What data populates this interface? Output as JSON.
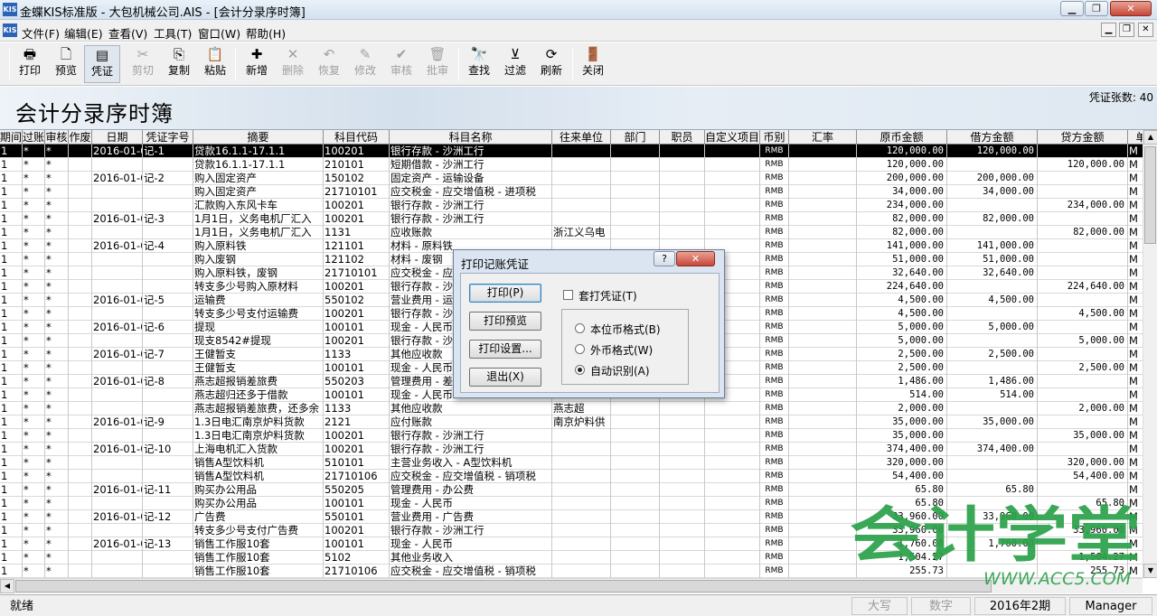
{
  "window": {
    "title": "金蝶KIS标准版 - 大包机械公司.AIS - [会计分录序时簿]",
    "app_icon": "KIS"
  },
  "menu": [
    "文件(F)",
    "编辑(E)",
    "查看(V)",
    "工具(T)",
    "窗口(W)",
    "帮助(H)"
  ],
  "toolbar": [
    {
      "label": "打印",
      "icon": "printer-icon",
      "enabled": true
    },
    {
      "label": "预览",
      "icon": "preview-icon",
      "enabled": true
    },
    {
      "label": "凭证",
      "icon": "voucher-icon",
      "enabled": true
    },
    {
      "label": "剪切",
      "icon": "cut-icon",
      "enabled": false
    },
    {
      "label": "复制",
      "icon": "copy-icon",
      "enabled": true
    },
    {
      "label": "粘贴",
      "icon": "paste-icon",
      "enabled": true
    },
    {
      "label": "新增",
      "icon": "new-icon",
      "enabled": true
    },
    {
      "label": "删除",
      "icon": "delete-icon",
      "enabled": false
    },
    {
      "label": "恢复",
      "icon": "undo-icon",
      "enabled": false
    },
    {
      "label": "修改",
      "icon": "edit-icon",
      "enabled": false
    },
    {
      "label": "审核",
      "icon": "audit-icon",
      "enabled": false
    },
    {
      "label": "批审",
      "icon": "batch-audit-icon",
      "enabled": false
    },
    {
      "label": "查找",
      "icon": "binoculars-icon",
      "enabled": true
    },
    {
      "label": "过滤",
      "icon": "filter-icon",
      "enabled": true
    },
    {
      "label": "刷新",
      "icon": "refresh-icon",
      "enabled": true
    },
    {
      "label": "关闭",
      "icon": "close-door-icon",
      "enabled": true
    }
  ],
  "report": {
    "title": "会计分录序时簿",
    "voucher_count": "凭证张数: 40"
  },
  "columns": [
    "期间",
    "过账",
    "审核",
    "作废",
    "日期",
    "凭证字号",
    "摘要",
    "科目代码",
    "科目名称",
    "往来单位",
    "部门",
    "职员",
    "自定义项目",
    "币别",
    "汇率",
    "原币金额",
    "借方金额",
    "贷方金额",
    "单"
  ],
  "rows": [
    [
      "1",
      "*",
      "*",
      "",
      "2016-01-0",
      "记-1",
      "贷款16.1.1-17.1.1",
      "100201",
      "银行存款 - 沙洲工行",
      "",
      "",
      "",
      "",
      "RMB",
      "",
      "120,000.00",
      "120,000.00",
      "",
      "M"
    ],
    [
      "1",
      "*",
      "*",
      "",
      "",
      "",
      "贷款16.1.1-17.1.1",
      "210101",
      "短期借款 - 沙洲工行",
      "",
      "",
      "",
      "",
      "RMB",
      "",
      "120,000.00",
      "",
      "120,000.00",
      "M"
    ],
    [
      "1",
      "*",
      "*",
      "",
      "2016-01-0",
      "记-2",
      "购入固定资产",
      "150102",
      "固定资产 - 运输设备",
      "",
      "",
      "",
      "",
      "RMB",
      "",
      "200,000.00",
      "200,000.00",
      "",
      "M"
    ],
    [
      "1",
      "*",
      "*",
      "",
      "",
      "",
      "购入固定资产",
      "21710101",
      "应交税金 - 应交增值税 - 进项税",
      "",
      "",
      "",
      "",
      "RMB",
      "",
      "34,000.00",
      "34,000.00",
      "",
      "M"
    ],
    [
      "1",
      "*",
      "*",
      "",
      "",
      "",
      "汇款购入东风卡车",
      "100201",
      "银行存款 - 沙洲工行",
      "",
      "",
      "",
      "",
      "RMB",
      "",
      "234,000.00",
      "",
      "234,000.00",
      "M"
    ],
    [
      "1",
      "*",
      "*",
      "",
      "2016-01-0",
      "记-3",
      "1月1日，义务电机厂汇入",
      "100201",
      "银行存款 - 沙洲工行",
      "",
      "",
      "",
      "",
      "RMB",
      "",
      "82,000.00",
      "82,000.00",
      "",
      "M"
    ],
    [
      "1",
      "*",
      "*",
      "",
      "",
      "",
      "1月1日，义务电机厂汇入",
      "1131",
      "应收账款",
      "浙江义乌电",
      "",
      "",
      "",
      "RMB",
      "",
      "82,000.00",
      "",
      "82,000.00",
      "M"
    ],
    [
      "1",
      "*",
      "*",
      "",
      "2016-01-0",
      "记-4",
      "购入原料铁",
      "121101",
      "材料 - 原料铁",
      "",
      "",
      "",
      "",
      "RMB",
      "",
      "141,000.00",
      "141,000.00",
      "",
      "M"
    ],
    [
      "1",
      "*",
      "*",
      "",
      "",
      "",
      "购入废钢",
      "121102",
      "材料 - 废钢",
      "",
      "",
      "",
      "",
      "RMB",
      "",
      "51,000.00",
      "51,000.00",
      "",
      "M"
    ],
    [
      "1",
      "*",
      "*",
      "",
      "",
      "",
      "购入原料铁，废钢",
      "21710101",
      "应交税金 - 应",
      "",
      "",
      "",
      "",
      "RMB",
      "",
      "32,640.00",
      "32,640.00",
      "",
      "M"
    ],
    [
      "1",
      "*",
      "*",
      "",
      "",
      "",
      "转支多少号购入原材料",
      "100201",
      "银行存款 - 沙",
      "",
      "",
      "",
      "",
      "RMB",
      "",
      "224,640.00",
      "",
      "224,640.00",
      "M"
    ],
    [
      "1",
      "*",
      "*",
      "",
      "2016-01-0",
      "记-5",
      "运输费",
      "550102",
      "营业费用 - 运",
      "",
      "",
      "",
      "",
      "RMB",
      "",
      "4,500.00",
      "4,500.00",
      "",
      "M"
    ],
    [
      "1",
      "*",
      "*",
      "",
      "",
      "",
      "转支多少号支付运输费",
      "100201",
      "银行存款 - 沙",
      "",
      "",
      "",
      "",
      "RMB",
      "",
      "4,500.00",
      "",
      "4,500.00",
      "M"
    ],
    [
      "1",
      "*",
      "*",
      "",
      "2016-01-0",
      "记-6",
      "提现",
      "100101",
      "现金 - 人民币",
      "",
      "",
      "",
      "",
      "RMB",
      "",
      "5,000.00",
      "5,000.00",
      "",
      "M"
    ],
    [
      "1",
      "*",
      "*",
      "",
      "",
      "",
      "现支8542#提现",
      "100201",
      "银行存款 - 沙",
      "",
      "",
      "",
      "",
      "RMB",
      "",
      "5,000.00",
      "",
      "5,000.00",
      "M"
    ],
    [
      "1",
      "*",
      "*",
      "",
      "2016-01-0",
      "记-7",
      "王健暂支",
      "1133",
      "其他应收款",
      "",
      "",
      "",
      "",
      "RMB",
      "",
      "2,500.00",
      "2,500.00",
      "",
      "M"
    ],
    [
      "1",
      "*",
      "*",
      "",
      "",
      "",
      "王健暂支",
      "100101",
      "现金 - 人民币",
      "",
      "",
      "",
      "",
      "RMB",
      "",
      "2,500.00",
      "",
      "2,500.00",
      "M"
    ],
    [
      "1",
      "*",
      "*",
      "",
      "2016-01-0",
      "记-8",
      "燕志超报销差旅费",
      "550203",
      "管理费用 - 差",
      "",
      "",
      "",
      "",
      "RMB",
      "",
      "1,486.00",
      "1,486.00",
      "",
      "M"
    ],
    [
      "1",
      "*",
      "*",
      "",
      "",
      "",
      "燕志超归还多于借款",
      "100101",
      "现金 - 人民币",
      "",
      "",
      "",
      "",
      "RMB",
      "",
      "514.00",
      "514.00",
      "",
      "M"
    ],
    [
      "1",
      "*",
      "*",
      "",
      "",
      "",
      "燕志超报销差旅费，还多余",
      "1133",
      "其他应收款",
      "燕志超",
      "",
      "",
      "",
      "RMB",
      "",
      "2,000.00",
      "",
      "2,000.00",
      "M"
    ],
    [
      "1",
      "*",
      "*",
      "",
      "2016-01-0",
      "记-9",
      "1.3日电汇南京炉料货款",
      "2121",
      "应付账款",
      "南京炉料供",
      "",
      "",
      "",
      "RMB",
      "",
      "35,000.00",
      "35,000.00",
      "",
      "M"
    ],
    [
      "1",
      "*",
      "*",
      "",
      "",
      "",
      "1.3日电汇南京炉料货款",
      "100201",
      "银行存款 - 沙洲工行",
      "",
      "",
      "",
      "",
      "RMB",
      "",
      "35,000.00",
      "",
      "35,000.00",
      "M"
    ],
    [
      "1",
      "*",
      "*",
      "",
      "2016-01-0",
      "记-10",
      "上海电机汇入货款",
      "100201",
      "银行存款 - 沙洲工行",
      "",
      "",
      "",
      "",
      "RMB",
      "",
      "374,400.00",
      "374,400.00",
      "",
      "M"
    ],
    [
      "1",
      "*",
      "*",
      "",
      "",
      "",
      "销售A型饮料机",
      "510101",
      "主营业务收入 - A型饮料机",
      "",
      "",
      "",
      "",
      "RMB",
      "",
      "320,000.00",
      "",
      "320,000.00",
      "M"
    ],
    [
      "1",
      "*",
      "*",
      "",
      "",
      "",
      "销售A型饮料机",
      "21710106",
      "应交税金 - 应交增值税 - 销项税",
      "",
      "",
      "",
      "",
      "RMB",
      "",
      "54,400.00",
      "",
      "54,400.00",
      "M"
    ],
    [
      "1",
      "*",
      "*",
      "",
      "2016-01-0",
      "记-11",
      "购买办公用品",
      "550205",
      "管理费用 - 办公费",
      "",
      "",
      "",
      "",
      "RMB",
      "",
      "65.80",
      "65.80",
      "",
      "M"
    ],
    [
      "1",
      "*",
      "*",
      "",
      "",
      "",
      "购买办公用品",
      "100101",
      "现金 - 人民币",
      "",
      "",
      "",
      "",
      "RMB",
      "",
      "65.80",
      "",
      "65.80",
      "M"
    ],
    [
      "1",
      "*",
      "*",
      "",
      "2016-01-0",
      "记-12",
      "广告费",
      "550101",
      "营业费用 - 广告费",
      "",
      "",
      "",
      "",
      "RMB",
      "",
      "33,960.00",
      "33,960.00",
      "",
      "M"
    ],
    [
      "1",
      "*",
      "*",
      "",
      "",
      "",
      "转支多少号支付广告费",
      "100201",
      "银行存款 - 沙洲工行",
      "",
      "",
      "",
      "",
      "RMB",
      "",
      "33,960.00",
      "",
      "33,960.00",
      "M"
    ],
    [
      "1",
      "*",
      "*",
      "",
      "2016-01-0",
      "记-13",
      "销售工作服10套",
      "100101",
      "现金 - 人民币",
      "",
      "",
      "",
      "",
      "RMB",
      "",
      "1,760.00",
      "1,760.00",
      "",
      "M"
    ],
    [
      "1",
      "*",
      "*",
      "",
      "",
      "",
      "销售工作服10套",
      "5102",
      "其他业务收入",
      "",
      "",
      "",
      "",
      "RMB",
      "",
      "1,504.27",
      "",
      "1,504.27",
      "M"
    ],
    [
      "1",
      "*",
      "*",
      "",
      "",
      "",
      "销售工作服10套",
      "21710106",
      "应交税金 - 应交增值税 - 销项税",
      "",
      "",
      "",
      "",
      "RMB",
      "",
      "255.73",
      "",
      "255.73",
      "M"
    ]
  ],
  "dialog": {
    "title": "打印记账凭证",
    "help": "?",
    "close": "✕",
    "buttons": [
      "打印(P)",
      "打印预览",
      "打印设置...",
      "退出(X)"
    ],
    "checkbox": {
      "label": "套打凭证(T)",
      "checked": false
    },
    "radios": [
      {
        "label": "本位币格式(B)",
        "selected": false
      },
      {
        "label": "外币格式(W)",
        "selected": false
      },
      {
        "label": "自动识别(A)",
        "selected": true
      }
    ]
  },
  "status": {
    "ready": "就绪",
    "caps": "大写",
    "num": "数字",
    "period": "2016年2期",
    "user": "Manager"
  },
  "watermark": {
    "main": "会计学堂",
    "url": "WWW.ACC5.COM",
    "color": "#2ca24a"
  }
}
